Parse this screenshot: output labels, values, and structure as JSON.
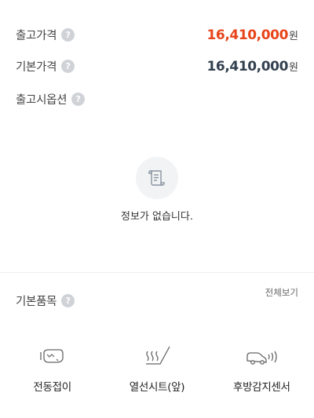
{
  "prices": {
    "release_price": {
      "label": "출고가격",
      "value": "16,410,000",
      "unit": "원",
      "color": "#e8431a"
    },
    "base_price": {
      "label": "기본가격",
      "value": "16,410,000",
      "unit": "원",
      "color": "#33404f"
    }
  },
  "options": {
    "label": "출고시옵션",
    "empty_message": "정보가 없습니다."
  },
  "basic_items": {
    "label": "기본품목",
    "see_all": "전체보기",
    "items": [
      {
        "name": "전동접이",
        "icon": "power-folding-mirror-icon"
      },
      {
        "name": "열선시트(앞)",
        "icon": "heated-seat-icon"
      },
      {
        "name": "후방감지센서",
        "icon": "rear-sensor-icon"
      }
    ]
  },
  "help_glyph": "?"
}
